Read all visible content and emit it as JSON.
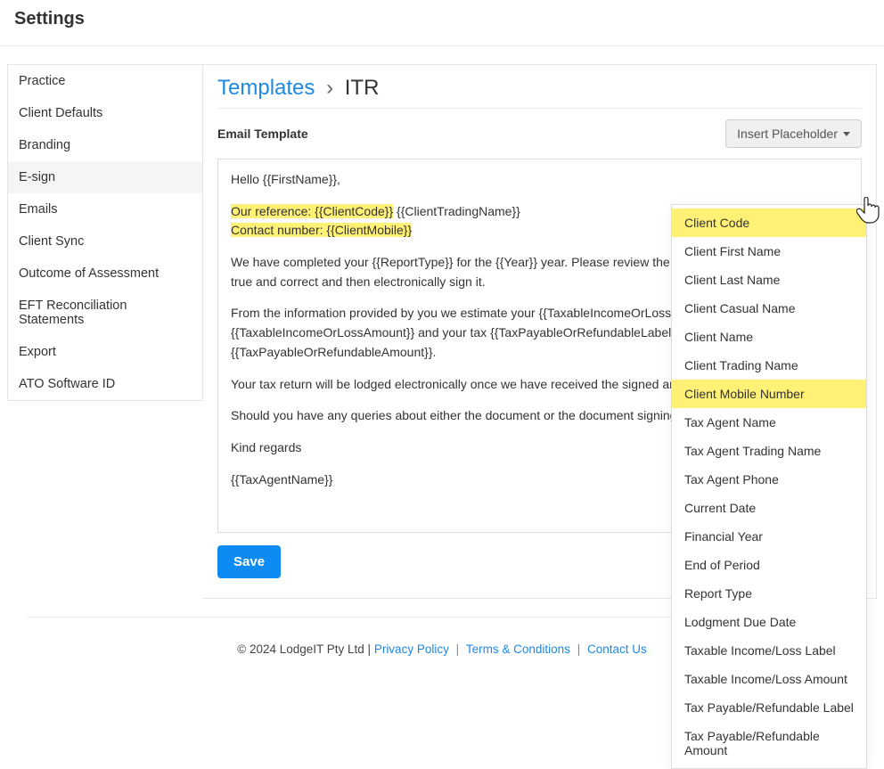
{
  "page_title": "Settings",
  "sidebar": {
    "items": [
      {
        "label": "Practice"
      },
      {
        "label": "Client Defaults"
      },
      {
        "label": "Branding"
      },
      {
        "label": "E-sign",
        "active": true
      },
      {
        "label": "Emails"
      },
      {
        "label": "Client Sync"
      },
      {
        "label": "Outcome of Assessment"
      },
      {
        "label": "EFT Reconciliation Statements"
      },
      {
        "label": "Export"
      },
      {
        "label": "ATO Software ID"
      }
    ]
  },
  "breadcrumb": {
    "root": "Templates",
    "sep": "›",
    "current": "ITR"
  },
  "section_label": "Email Template",
  "insert_button_label": "Insert Placeholder",
  "save_label": "Save",
  "template_body": {
    "greeting": "Hello {{FirstName}},",
    "ref_prefix": "Our reference: ",
    "ref_code": "{{ClientCode}}",
    "ref_trading": " {{ClientTradingName}}",
    "contact_prefix": "Contact number: ",
    "contact_mobile": "{{ClientMobile}}",
    "para1": "We have completed your {{ReportType}} for the {{Year}} year. Please review the tax return, ensure all items are true and correct and then electronically sign it.",
    "para2": "From the information provided by you we estimate your {{TaxableIncomeOrLossLabel}} to be {{TaxableIncomeOrLossAmount}} and your tax {{TaxPayableOrRefundableLabel}} as {{TaxPayableOrRefundableAmount}}.",
    "para3": "Your tax return will be lodged electronically once we have received the signed and dated declaration.",
    "para4": "Should you have any queries about either the document or the document signing process please contact us.",
    "para5": "Kind regards",
    "para6": "{{TaxAgentName}}"
  },
  "placeholder_menu": [
    {
      "label": "Client Code",
      "hl": true
    },
    {
      "label": "Client First Name"
    },
    {
      "label": "Client Last Name"
    },
    {
      "label": "Client Casual Name"
    },
    {
      "label": "Client Name"
    },
    {
      "label": "Client Trading Name"
    },
    {
      "label": "Client Mobile Number",
      "hl": true
    },
    {
      "label": "Tax Agent Name"
    },
    {
      "label": "Tax Agent Trading Name"
    },
    {
      "label": "Tax Agent Phone"
    },
    {
      "label": "Current Date"
    },
    {
      "label": "Financial Year"
    },
    {
      "label": "End of Period"
    },
    {
      "label": "Report Type"
    },
    {
      "label": "Lodgment Due Date"
    },
    {
      "label": "Taxable Income/Loss Label"
    },
    {
      "label": "Taxable Income/Loss Amount"
    },
    {
      "label": "Tax Payable/Refundable Label"
    },
    {
      "label": "Tax Payable/Refundable Amount"
    }
  ],
  "footer": {
    "copyright": "© 2024 LodgeIT Pty Ltd | ",
    "privacy": "Privacy Policy",
    "terms": "Terms & Conditions",
    "contact": "Contact Us",
    "pipe": " | "
  }
}
